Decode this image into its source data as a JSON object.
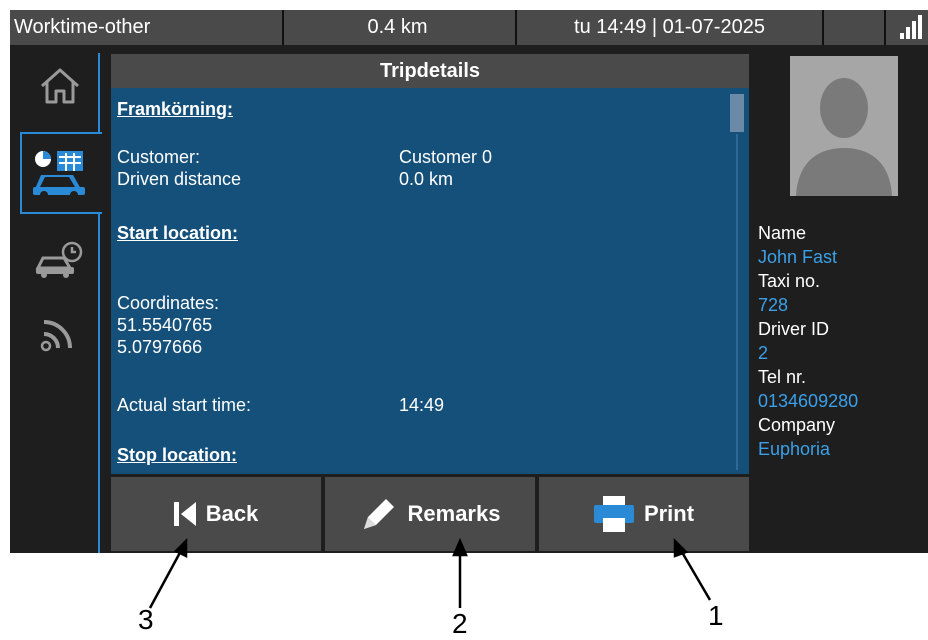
{
  "status": {
    "mode": "Worktime-other",
    "distance": "0.4 km",
    "datetime": "tu 14:49 | 01-07-2025",
    "signal_icon": "signal-bars-icon"
  },
  "nav": {
    "items": [
      {
        "icon": "home-icon"
      },
      {
        "icon": "taxi-trip-icon",
        "active": true
      },
      {
        "icon": "car-clock-icon"
      },
      {
        "icon": "wifi-signal-icon"
      }
    ]
  },
  "trip": {
    "title": "Tripdetails",
    "section_drive": "Framkörning:",
    "customer_label": "Customer:",
    "customer_value": "Customer 0",
    "distance_label": "Driven distance",
    "distance_value": "0.0 km",
    "section_start": "Start location:",
    "coords_label": "Coordinates:",
    "lat": "51.5540765",
    "lon": "5.0797666",
    "start_time_label": "Actual start time:",
    "start_time_value": "14:49",
    "section_stop": "Stop location:"
  },
  "buttons": {
    "back": "Back",
    "remarks": "Remarks",
    "print": "Print"
  },
  "driver": {
    "name_label": "Name",
    "name_value": "John Fast",
    "taxi_label": "Taxi no.",
    "taxi_value": "728",
    "driver_id_label": "Driver ID",
    "driver_id_value": "2",
    "tel_label": "Tel nr.",
    "tel_value": "0134609280",
    "company_label": "Company",
    "company_value": "Euphoria"
  },
  "annotations": {
    "one": "1",
    "two": "2",
    "three": "3"
  },
  "colors": {
    "accent": "#2a8ad6",
    "panel": "#15507a",
    "value_text": "#3aa0ea"
  }
}
